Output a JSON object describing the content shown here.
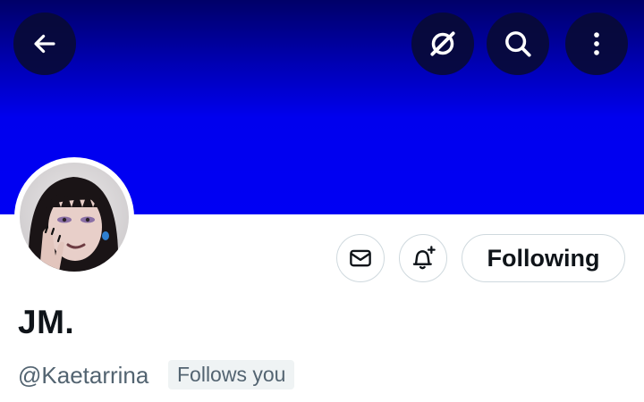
{
  "header": {
    "back_icon": "arrow-left-icon",
    "grok_icon": "grok-icon",
    "search_icon": "search-icon",
    "more_icon": "more-vertical-icon"
  },
  "banner": {
    "color": "#0000f4"
  },
  "profile": {
    "display_name": "JM.",
    "handle": "@Kaetarrina",
    "follows_you_label": "Follows you"
  },
  "actions": {
    "message_icon": "mail-icon",
    "notify_icon": "bell-plus-icon",
    "following_label": "Following"
  },
  "colors": {
    "text_primary": "#0f1419",
    "text_secondary": "#536471",
    "border": "#cfd9de"
  }
}
